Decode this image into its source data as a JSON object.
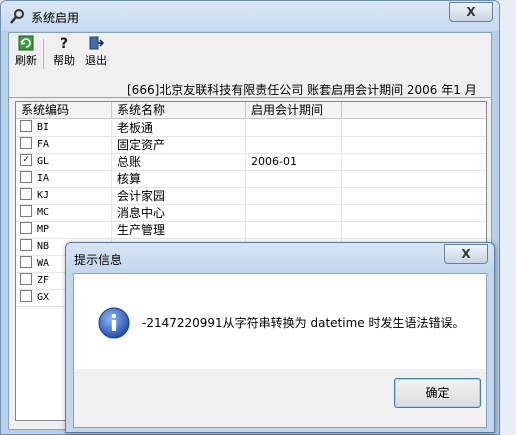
{
  "window": {
    "title": "系统启用",
    "close_label": "X"
  },
  "toolbar": {
    "refresh_label": "刷新",
    "help_label": "帮助",
    "exit_label": "退出"
  },
  "info_line": "[666]北京友联科技有限责任公司 账套启用会计期间 2006 年1 月",
  "grid": {
    "headers": [
      "系统编码",
      "系统名称",
      "启用会计期间"
    ],
    "rows": [
      {
        "code": "BI",
        "name": "老板通",
        "period": "",
        "checked": false
      },
      {
        "code": "FA",
        "name": "固定资产",
        "period": "",
        "checked": false
      },
      {
        "code": "GL",
        "name": "总账",
        "period": "2006-01",
        "checked": true
      },
      {
        "code": "IA",
        "name": "核算",
        "period": "",
        "checked": false
      },
      {
        "code": "KJ",
        "name": "会计家园",
        "period": "",
        "checked": false
      },
      {
        "code": "MC",
        "name": "消息中心",
        "period": "",
        "checked": false
      },
      {
        "code": "MP",
        "name": "生产管理",
        "period": "",
        "checked": false
      },
      {
        "code": "NB",
        "name": "",
        "period": "",
        "checked": false
      },
      {
        "code": "WA",
        "name": "",
        "period": "",
        "checked": false
      },
      {
        "code": "ZF",
        "name": "",
        "period": "",
        "checked": false
      },
      {
        "code": "GX",
        "name": "",
        "period": "",
        "checked": false
      }
    ]
  },
  "dialog": {
    "title": "提示信息",
    "close_label": "X",
    "message": "-2147220991从字符串转换为 datetime 时发生语法错误。",
    "ok_label": "确定"
  },
  "colors": {
    "title_bar": "#c5d9ee",
    "client_bg": "#f0f0f0",
    "info_icon": "#2a63c7",
    "button_border": "#3c7fb1"
  }
}
